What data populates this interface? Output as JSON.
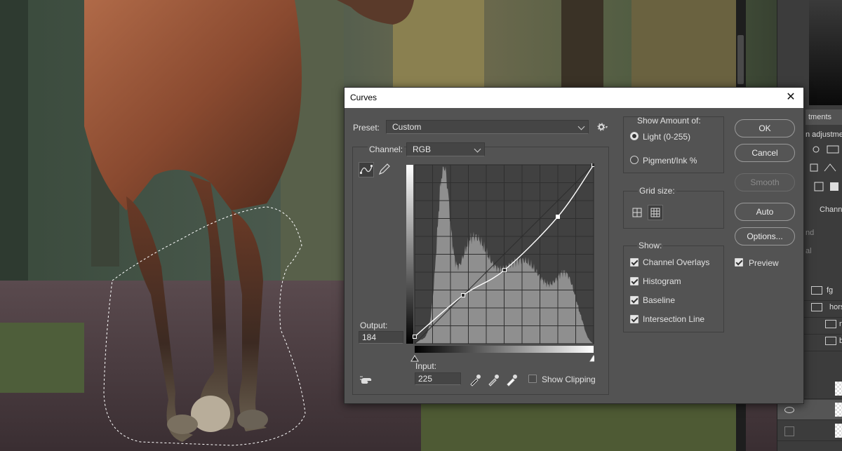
{
  "dialog": {
    "title": "Curves",
    "close_glyph": "✕",
    "preset_label": "Preset:",
    "preset_value": "Custom",
    "channel_label": "Channel:",
    "channel_value": "RGB",
    "output_label": "Output:",
    "output_value": "184",
    "input_label": "Input:",
    "input_value": "225",
    "show_clipping_label": "Show Clipping",
    "show_clipping_checked": false,
    "show_amount": {
      "heading": "Show Amount of:",
      "light_label": "Light  (0-255)",
      "pigment_label": "Pigment/Ink %",
      "selected": "light"
    },
    "grid_size": {
      "heading": "Grid size:",
      "selected": "fine"
    },
    "show": {
      "heading": "Show:",
      "items": [
        {
          "label": "Channel Overlays",
          "checked": true
        },
        {
          "label": "Histogram",
          "checked": true
        },
        {
          "label": "Baseline",
          "checked": true
        },
        {
          "label": "Intersection Line",
          "checked": true
        }
      ]
    },
    "buttons": {
      "ok": "OK",
      "cancel": "Cancel",
      "smooth": "Smooth",
      "auto": "Auto",
      "options": "Options..."
    },
    "preview_label": "Preview",
    "preview_checked": true,
    "curve_points": [
      [
        0,
        10
      ],
      [
        69,
        69
      ],
      [
        128,
        105
      ],
      [
        204,
        181
      ],
      [
        255,
        255
      ]
    ]
  },
  "right_panel": {
    "tab_adjustments": "tments",
    "adjust_hint": "n adjustme",
    "tab_channels": "Channel",
    "blend_mode": "nd",
    "opacity_hint": "al",
    "layers": [
      "fg",
      "hors",
      "n",
      "b"
    ]
  },
  "colors": {
    "dialog_bg": "#535353",
    "graph_bg": "#414141",
    "histogram": "#8f8f8f"
  }
}
